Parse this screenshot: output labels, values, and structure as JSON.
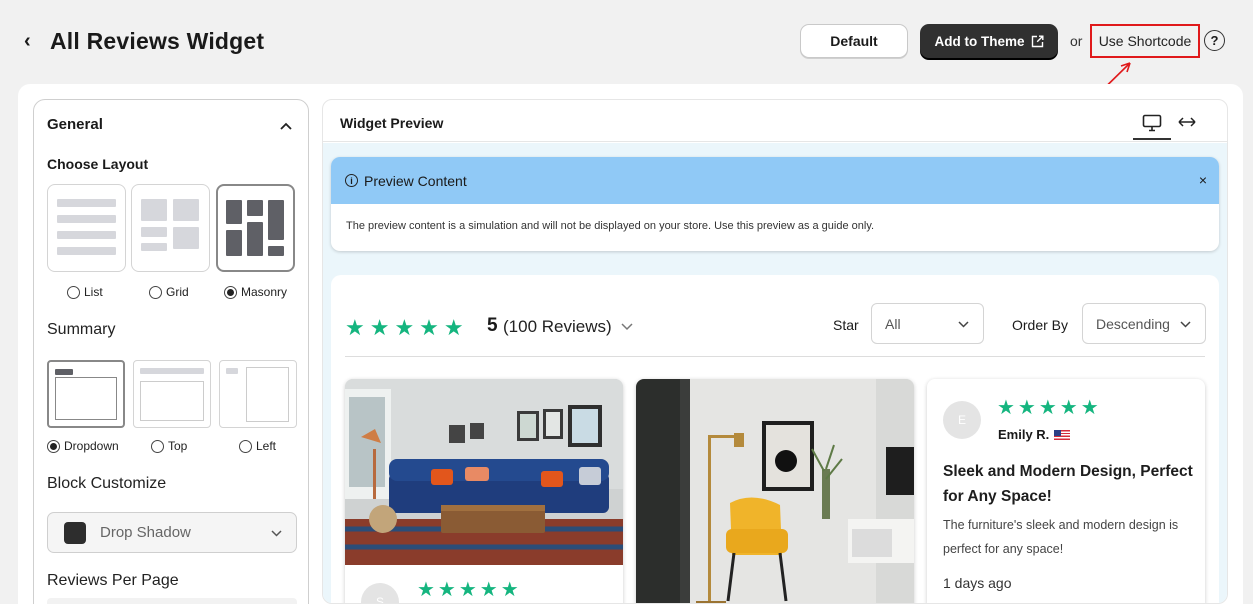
{
  "header": {
    "back_glyph": "‹",
    "title": "All Reviews Widget",
    "default_label": "Default",
    "add_theme_label": "Add to Theme",
    "or_text": "or",
    "shortcode_label": "Use Shortcode",
    "help_glyph": "?"
  },
  "settings": {
    "section_title": "General",
    "collapse_glyph": "^",
    "layout_label": "Choose Layout",
    "layouts": [
      "List",
      "Grid",
      "Masonry"
    ],
    "selected_layout": "Masonry",
    "summary_label": "Summary",
    "summary_options": [
      "Dropdown",
      "Top",
      "Left"
    ],
    "selected_summary": "Dropdown",
    "block_label": "Block Customize",
    "block_value": "Drop Shadow",
    "rpp_label": "Reviews Per Page"
  },
  "preview": {
    "title": "Widget Preview",
    "notice_title": "Preview Content",
    "notice_close": "×",
    "notice_text": "The preview content is a simulation and will not be displayed on your store. Use this preview as a guide only.",
    "rating_stars": "★★★★★",
    "rating_value": "5",
    "rating_count": "(100 Reviews)",
    "star_label": "Star",
    "star_value": "All",
    "order_label": "Order By",
    "order_value": "Descending"
  },
  "reviews": [
    {
      "avatar": "S",
      "stars": "★★★★★"
    },
    {
      "avatar": "E",
      "stars": "★★★★★",
      "name": "Emily R.",
      "title": "Sleek and Modern Design, Perfect for Any Space!",
      "text": "The furniture's sleek and modern design is perfect for any space!",
      "date": "1 days ago"
    }
  ],
  "colors": {
    "accent": "#15b57f",
    "notice_bg": "#90c9f6",
    "highlight_box": "#e0191b",
    "primary_button": "#303030"
  },
  "icons": [
    "back-chevron-icon",
    "external-link-icon",
    "help-icon",
    "chevron-up-icon",
    "info-icon",
    "close-icon",
    "desktop-icon",
    "horizontal-resize-icon",
    "chevron-down-icon",
    "us-flag-icon"
  ]
}
